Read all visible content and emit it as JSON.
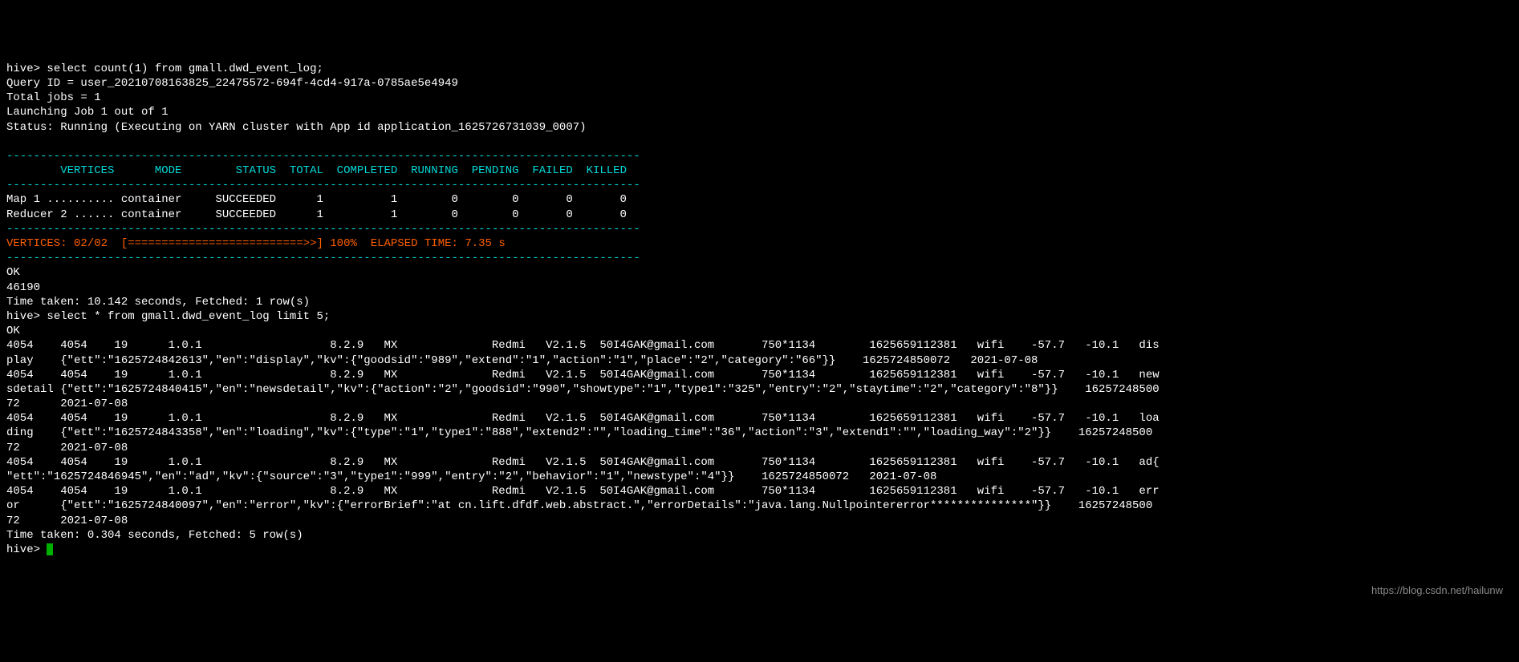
{
  "prompt1": "hive> ",
  "query1": "select count(1) from gmall.dwd_event_log;",
  "queryId": "Query ID = user_20210708163825_22475572-694f-4cd4-917a-0785ae5e4949",
  "totalJobs": "Total jobs = 1",
  "launching": "Launching Job 1 out of 1",
  "status": "Status: Running (Executing on YARN cluster with App id application_1625726731039_0007)",
  "dashes1": "----------------------------------------------------------------------------------------------",
  "header": {
    "vertices": "        VERTICES",
    "mode": "      MODE",
    "status": "        STATUS",
    "total": "  TOTAL",
    "completed": "  COMPLETED",
    "running": "  RUNNING",
    "pending": "  PENDING",
    "failed": "  FAILED",
    "killed": "  KILLED"
  },
  "dashes2": "----------------------------------------------------------------------------------------------",
  "row1": "Map 1 .......... container     SUCCEEDED      1          1        0        0       0       0  ",
  "row2": "Reducer 2 ...... container     SUCCEEDED      1          1        0        0       0       0  ",
  "dashes3": "----------------------------------------------------------------------------------------------",
  "progress": {
    "vertices": "VERTICES: 02/02",
    "bar": "  [==========================>>] 100%",
    "elapsed": "  ELAPSED TIME: 7.35 s     "
  },
  "dashes4": "----------------------------------------------------------------------------------------------",
  "ok1": "OK",
  "count": "46190",
  "timeTaken1": "Time taken: 10.142 seconds, Fetched: 1 row(s)",
  "prompt2": "hive> ",
  "query2": "select * from gmall.dwd_event_log limit 5;",
  "ok2": "OK",
  "dataRow1a": "4054    4054    19      1.0.1                   8.2.9   MX              Redmi   V2.1.5  50I4GAK@gmail.com       750*1134        1625659112381   wifi    -57.7   -10.1   dis",
  "dataRow1b": "play    {\"ett\":\"1625724842613\",\"en\":\"display\",\"kv\":{\"goodsid\":\"989\",\"extend\":\"1\",\"action\":\"1\",\"place\":\"2\",\"category\":\"66\"}}    1625724850072   2021-07-08",
  "dataRow2a": "4054    4054    19      1.0.1                   8.2.9   MX              Redmi   V2.1.5  50I4GAK@gmail.com       750*1134        1625659112381   wifi    -57.7   -10.1   new",
  "dataRow2b": "sdetail {\"ett\":\"1625724840415\",\"en\":\"newsdetail\",\"kv\":{\"action\":\"2\",\"goodsid\":\"990\",\"showtype\":\"1\",\"type1\":\"325\",\"entry\":\"2\",\"staytime\":\"2\",\"category\":\"8\"}}    16257248500",
  "dataRow2c": "72      2021-07-08",
  "dataRow3a": "4054    4054    19      1.0.1                   8.2.9   MX              Redmi   V2.1.5  50I4GAK@gmail.com       750*1134        1625659112381   wifi    -57.7   -10.1   loa",
  "dataRow3b": "ding    {\"ett\":\"1625724843358\",\"en\":\"loading\",\"kv\":{\"type\":\"1\",\"type1\":\"888\",\"extend2\":\"\",\"loading_time\":\"36\",\"action\":\"3\",\"extend1\":\"\",\"loading_way\":\"2\"}}    16257248500",
  "dataRow3c": "72      2021-07-08",
  "dataRow4a": "4054    4054    19      1.0.1                   8.2.9   MX              Redmi   V2.1.5  50I4GAK@gmail.com       750*1134        1625659112381   wifi    -57.7   -10.1   ad{",
  "dataRow4b": "\"ett\":\"1625724846945\",\"en\":\"ad\",\"kv\":{\"source\":\"3\",\"type1\":\"999\",\"entry\":\"2\",\"behavior\":\"1\",\"newstype\":\"4\"}}    1625724850072   2021-07-08",
  "dataRow5a": "4054    4054    19      1.0.1                   8.2.9   MX              Redmi   V2.1.5  50I4GAK@gmail.com       750*1134        1625659112381   wifi    -57.7   -10.1   err",
  "dataRow5b": "or      {\"ett\":\"1625724840097\",\"en\":\"error\",\"kv\":{\"errorBrief\":\"at cn.lift.dfdf.web.abstract.\",\"errorDetails\":\"java.lang.Nullpointererror***************\"}}    16257248500",
  "dataRow5c": "72      2021-07-08",
  "timeTaken2": "Time taken: 0.304 seconds, Fetched: 5 row(s)",
  "prompt3": "hive> ",
  "watermark": "https://blog.csdn.net/hailunw"
}
